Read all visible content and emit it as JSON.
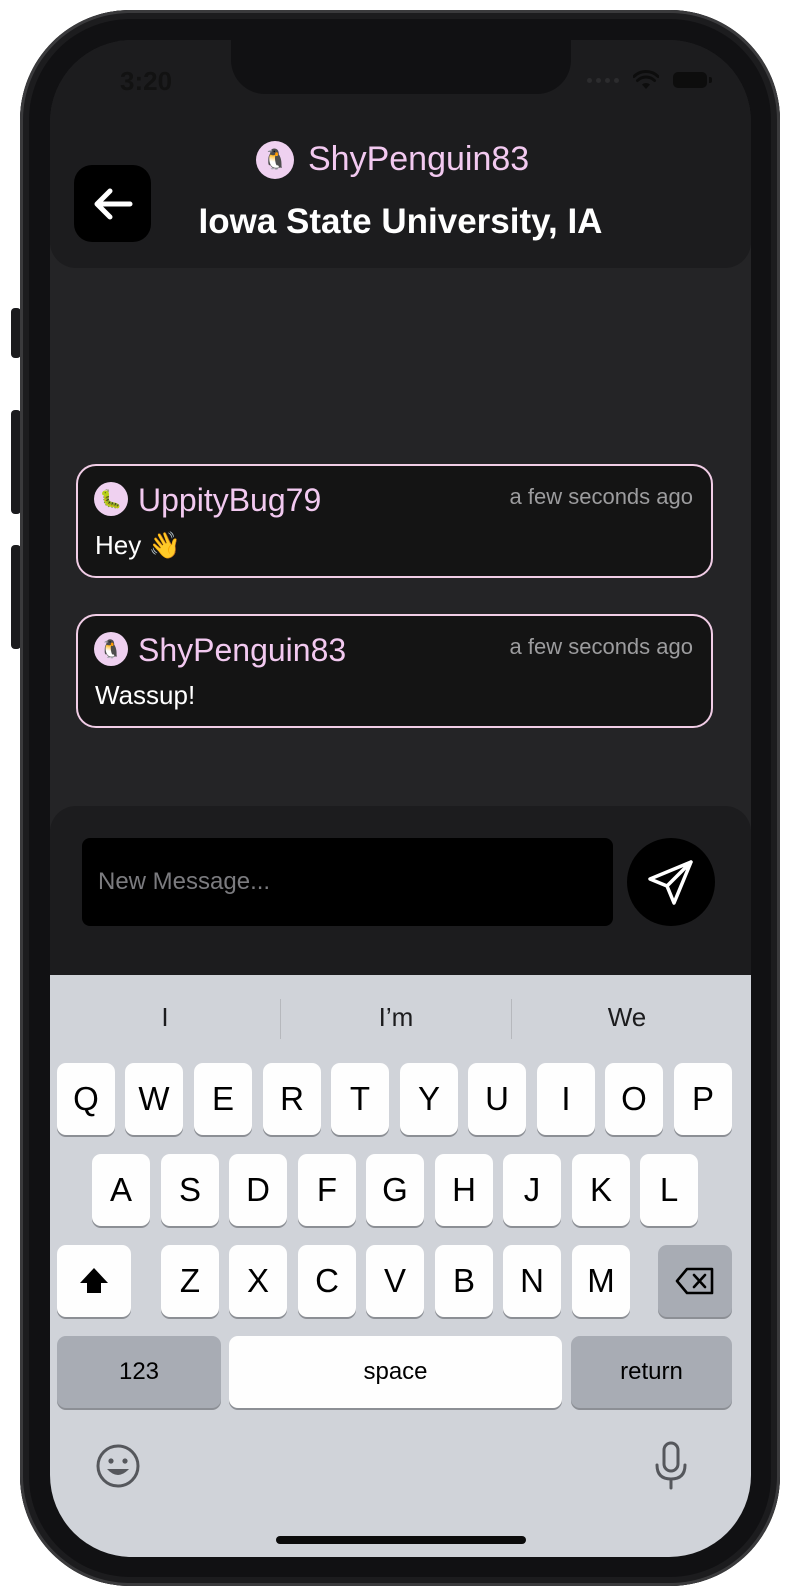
{
  "status_bar": {
    "time": "3:20"
  },
  "header": {
    "username": "ShyPenguin83",
    "avatar_emoji": "🐧",
    "location": "Iowa State University, IA",
    "back_icon": "arrow-left-icon"
  },
  "messages": [
    {
      "username": "UppityBug79",
      "avatar_emoji": "🐛",
      "time": "a few seconds ago",
      "text": "Hey 👋"
    },
    {
      "username": "ShyPenguin83",
      "avatar_emoji": "🐧",
      "time": "a few seconds ago",
      "text": "Wassup!"
    }
  ],
  "composer": {
    "placeholder": "New Message...",
    "send_icon": "paper-plane-icon"
  },
  "keyboard": {
    "suggestions": [
      "I",
      "I’m",
      "We"
    ],
    "row1": [
      "Q",
      "W",
      "E",
      "R",
      "T",
      "Y",
      "U",
      "I",
      "O",
      "P"
    ],
    "row2": [
      "A",
      "S",
      "D",
      "F",
      "G",
      "H",
      "J",
      "K",
      "L"
    ],
    "row3": [
      "Z",
      "X",
      "C",
      "V",
      "B",
      "N",
      "M"
    ],
    "numbers_label": "123",
    "space_label": "space",
    "return_label": "return"
  },
  "colors": {
    "accent_pink": "#f2c9f0",
    "background": "#242426",
    "header_bg": "#1c1c1e",
    "keyboard_bg": "#d0d3d9"
  }
}
